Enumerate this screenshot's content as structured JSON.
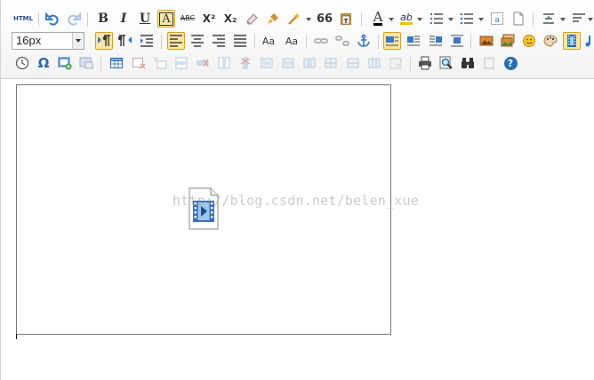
{
  "toolbar": {
    "source_label": "HTML",
    "bold_label": "B",
    "italic_label": "I",
    "underline_label": "U",
    "fontborder_label": "A",
    "strike_label": "ABC",
    "superscript_label": "X²",
    "subscript_label": "X₂",
    "blockquote_label": "66",
    "forecolor_label": "A",
    "backcolor_label": "ab",
    "fontsize_value": "16px",
    "touppercase_label": "Aa",
    "tolowercase_label": "Aa",
    "specialchar_label": "Ω",
    "help_label": "?"
  },
  "content": {
    "watermark": "http://blog.csdn.net/belen_xue"
  },
  "colors": {
    "active_bg": "#fde6a8",
    "active_border": "#d4a02a",
    "icon_blue": "#3a78c2",
    "video_blue": "#3b6db0"
  }
}
